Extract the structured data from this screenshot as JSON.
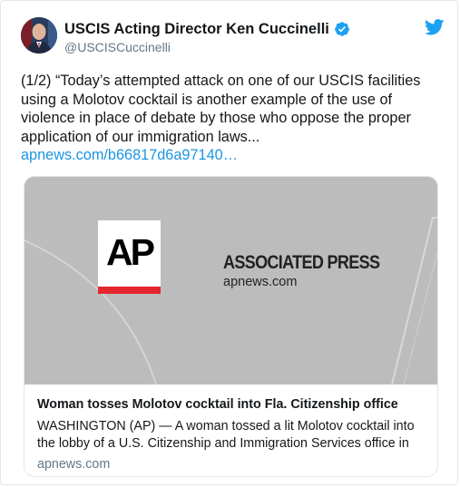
{
  "author": {
    "display_name": "USCIS Acting Director Ken Cuccinelli",
    "handle": "@USCISCuccinelli",
    "verified_icon": "verified-badge-icon"
  },
  "brand": {
    "icon": "twitter-bird-icon",
    "accent": "#1da1f2"
  },
  "tweet": {
    "text": "(1/2) “Today’s attempted attack on one of our USCIS facilities using a Molotov cocktail is another example of the use of violence in place of debate by those who oppose the proper application of our immigration laws...",
    "link": "apnews.com/b66817d6a97140…",
    "link_color": "#1b95e0"
  },
  "card": {
    "image": {
      "logo_letters": "AP",
      "wordmark": "ASSOCIATED PRESS",
      "domain": "apnews.com",
      "logo_bar_color": "#e3262d",
      "background": "#bcbcbc"
    },
    "title": "Woman tosses Molotov cocktail into Fla. Citizenship office",
    "description": "WASHINGTON (AP) — A woman tossed a lit Molotov cocktail into the lobby of a U.S. Citizenship and Immigration Services office in",
    "domain": "apnews.com"
  }
}
